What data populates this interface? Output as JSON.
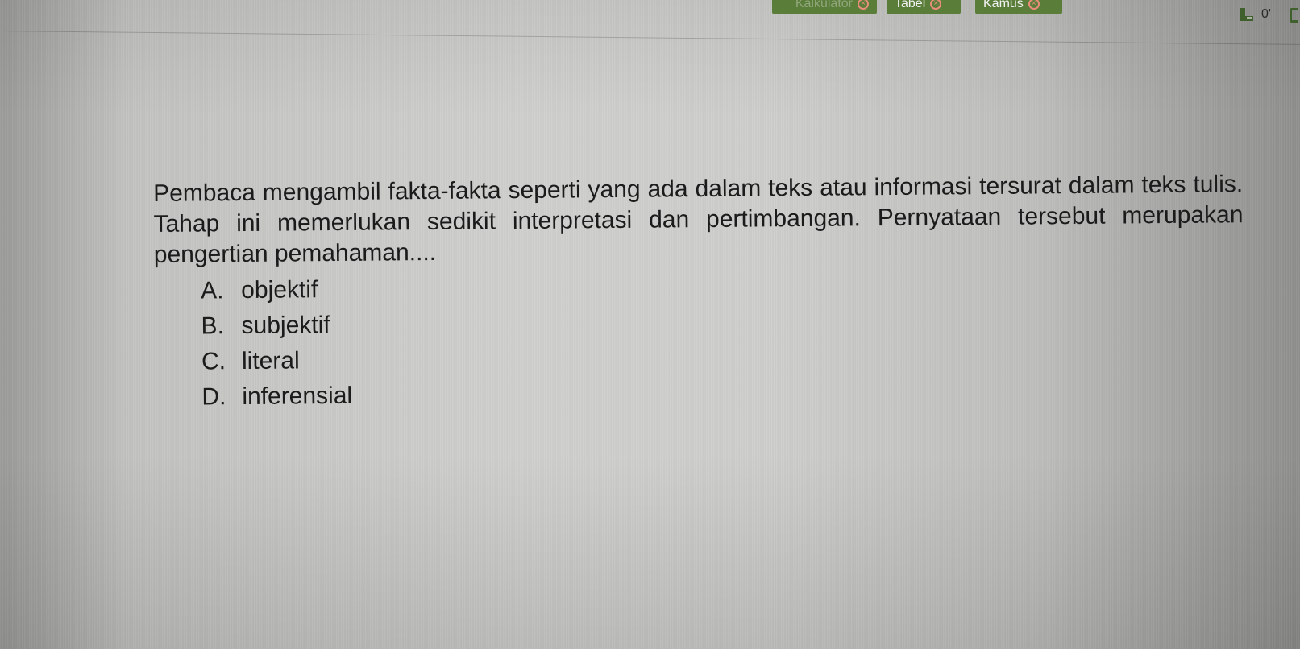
{
  "toolbar": {
    "kalkulator_label": "Kalkulator",
    "tabel_label": "Tabel",
    "kamus_label": "Kamus",
    "close_glyph": "×",
    "counter_value": "0'",
    "button_color": "#5b7d3a",
    "close_color": "#e98d7b"
  },
  "question": {
    "text": "Pembaca mengambil fakta-fakta seperti yang ada dalam teks atau informasi tersurat dalam teks tulis. Tahap ini memerlukan sedikit interpretasi dan pertimbangan. Pernyataan tersebut merupakan pengertian pemahaman....",
    "options": [
      {
        "letter": "A.",
        "text": "objektif"
      },
      {
        "letter": "B.",
        "text": "subjektif"
      },
      {
        "letter": "C.",
        "text": "literal"
      },
      {
        "letter": "D.",
        "text": "inferensial"
      }
    ]
  }
}
